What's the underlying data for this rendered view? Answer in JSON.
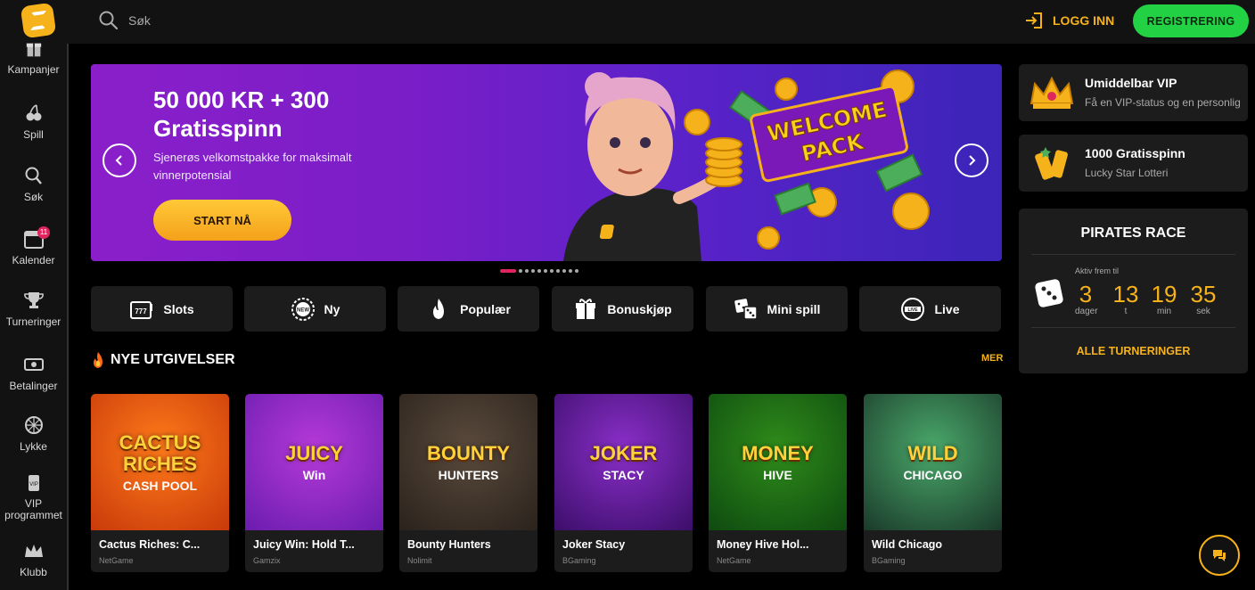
{
  "header": {
    "search_placeholder": "Søk",
    "login_label": "LOGG INN",
    "register_label": "REGISTRERING"
  },
  "sidebar": {
    "items": [
      {
        "label": "Kampanjer",
        "icon": "gift-icon"
      },
      {
        "label": "Spill",
        "icon": "cherry-icon"
      },
      {
        "label": "Søk",
        "icon": "search-icon"
      },
      {
        "label": "Kalender",
        "icon": "calendar-icon",
        "badge": "11"
      },
      {
        "label": "Turneringer",
        "icon": "trophy-icon"
      },
      {
        "label": "Betalinger",
        "icon": "wallet-icon"
      },
      {
        "label": "Lykke",
        "icon": "wheel-icon"
      },
      {
        "label": "VIP programmet",
        "icon": "vip-icon"
      },
      {
        "label": "Klubb",
        "icon": "crown-icon"
      }
    ]
  },
  "hero": {
    "title": "50 000 KR + 300 Gratisspinn",
    "subtitle": "Sjenerøs velkomstpakke for maksimalt vinnerpotensial",
    "cta": "START NÅ",
    "art_text": "WELCOME PACK",
    "slide_count": 11,
    "active_slide": 0
  },
  "categories": [
    {
      "label": "Slots",
      "icon": "slot-777-icon"
    },
    {
      "label": "Ny",
      "icon": "new-badge-icon"
    },
    {
      "label": "Populær",
      "icon": "fire-icon"
    },
    {
      "label": "Bonuskjøp",
      "icon": "gift-icon"
    },
    {
      "label": "Mini spill",
      "icon": "dice-icon"
    },
    {
      "label": "Live",
      "icon": "live-icon"
    }
  ],
  "new_releases": {
    "title": "NYE UTGIVELSER",
    "more": "MER",
    "games": [
      {
        "name": "Cactus Riches: C...",
        "provider": "NetGame",
        "art": "CACTUS RICHES",
        "art2": "CASH POOL",
        "colors": [
          "#ff7a1a",
          "#c83a0a"
        ]
      },
      {
        "name": "Juicy Win: Hold T...",
        "provider": "Gamzix",
        "art": "JUICY",
        "art2": "Win",
        "colors": [
          "#b63ad8",
          "#6a1cae"
        ]
      },
      {
        "name": "Bounty Hunters",
        "provider": "Nolimit",
        "art": "BOUNTY",
        "art2": "HUNTERS",
        "colors": [
          "#5a4a3c",
          "#2a221c"
        ]
      },
      {
        "name": "Joker Stacy",
        "provider": "BGaming",
        "art": "JOKER",
        "art2": "STACY",
        "colors": [
          "#8a2fc9",
          "#3c0e6a"
        ]
      },
      {
        "name": "Money Hive Hol...",
        "provider": "NetGame",
        "art": "MONEY",
        "art2": "HIVE",
        "colors": [
          "#2f8c1a",
          "#0e4a10"
        ]
      },
      {
        "name": "Wild Chicago",
        "provider": "BGaming",
        "art": "WILD",
        "art2": "CHICAGO",
        "colors": [
          "#4aa86a",
          "#1a3a2a"
        ]
      }
    ]
  },
  "promos": [
    {
      "title": "Umiddelbar VIP",
      "subtitle": "Få en VIP-status og en personlig",
      "icon": "crown-icon"
    },
    {
      "title": "1000 Gratisspinn",
      "subtitle": "Lucky Star Lotteri",
      "icon": "ticket-icon"
    }
  ],
  "race": {
    "title": "PIRATES RACE",
    "active_label": "Aktiv frem til",
    "countdown": [
      {
        "value": "3",
        "unit": "dager"
      },
      {
        "value": "13",
        "unit": "t"
      },
      {
        "value": "19",
        "unit": "min"
      },
      {
        "value": "35",
        "unit": "sek"
      }
    ],
    "link": "ALLE TURNERINGER"
  },
  "colors": {
    "accent": "#f6b21b",
    "register": "#23d145",
    "badge": "#e0245e"
  }
}
